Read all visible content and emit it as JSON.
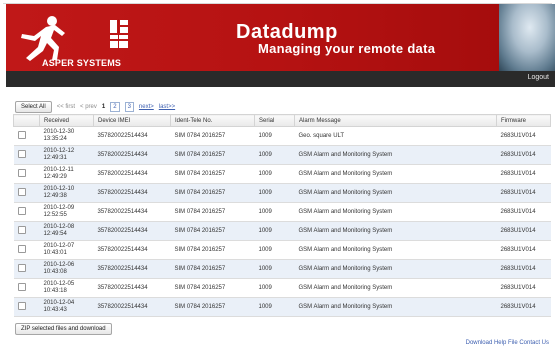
{
  "brand": {
    "company": "ASPER SYSTEMS",
    "title": "Datadump",
    "subtitle": "Managing your remote data"
  },
  "nav": {
    "logout": "Logout"
  },
  "toolbar": {
    "select_all": "Select All",
    "first": "<< first",
    "prev": "< prev",
    "page_current": "1",
    "page_2": "2",
    "page_3": "3",
    "next": "next>",
    "last": "last>>"
  },
  "table": {
    "columns": [
      "",
      "Received",
      "Device IMEI",
      "Ident-Tele No.",
      "Serial",
      "Alarm Message",
      "Firmware"
    ],
    "rows": [
      {
        "date": "2010-12-30",
        "time": "13:35:24",
        "imei": "357820022514434",
        "ident": "SIM 0784 2016257",
        "serial": "1009",
        "message": "Geo. square ULT",
        "firmware": "2683U1V014"
      },
      {
        "date": "2010-12-12",
        "time": "12:49:31",
        "imei": "357820022514434",
        "ident": "SIM 0784 2016257",
        "serial": "1009",
        "message": "GSM Alarm and Monitoring System",
        "firmware": "2683U1V014"
      },
      {
        "date": "2010-12-11",
        "time": "12:49:29",
        "imei": "357820022514434",
        "ident": "SIM 0784 2016257",
        "serial": "1009",
        "message": "GSM Alarm and Monitoring System",
        "firmware": "2683U1V014"
      },
      {
        "date": "2010-12-10",
        "time": "12:49:38",
        "imei": "357820022514434",
        "ident": "SIM 0784 2016257",
        "serial": "1009",
        "message": "GSM Alarm and Monitoring System",
        "firmware": "2683U1V014"
      },
      {
        "date": "2010-12-09",
        "time": "12:52:55",
        "imei": "357820022514434",
        "ident": "SIM 0784 2016257",
        "serial": "1009",
        "message": "GSM Alarm and Monitoring System",
        "firmware": "2683U1V014"
      },
      {
        "date": "2010-12-08",
        "time": "12:49:54",
        "imei": "357820022514434",
        "ident": "SIM 0784 2016257",
        "serial": "1009",
        "message": "GSM Alarm and Monitoring System",
        "firmware": "2683U1V014"
      },
      {
        "date": "2010-12-07",
        "time": "10:43:01",
        "imei": "357820022514434",
        "ident": "SIM 0784 2016257",
        "serial": "1009",
        "message": "GSM Alarm and Monitoring System",
        "firmware": "2683U1V014"
      },
      {
        "date": "2010-12-06",
        "time": "10:43:08",
        "imei": "357820022514434",
        "ident": "SIM 0784 2016257",
        "serial": "1009",
        "message": "GSM Alarm and Monitoring System",
        "firmware": "2683U1V014"
      },
      {
        "date": "2010-12-05",
        "time": "10:43:18",
        "imei": "357820022514434",
        "ident": "SIM 0784 2016257",
        "serial": "1009",
        "message": "GSM Alarm and Monitoring System",
        "firmware": "2683U1V014"
      },
      {
        "date": "2010-12-04",
        "time": "10:43:43",
        "imei": "357820022514434",
        "ident": "SIM 0784 2016257",
        "serial": "1009",
        "message": "GSM Alarm and Monitoring System",
        "firmware": "2683U1V014"
      }
    ]
  },
  "actions": {
    "zip": "ZIP selected files and download"
  },
  "footer": {
    "links": "Download Help File Contact Us"
  },
  "colors": {
    "brand_red": "#b51212",
    "nav_dark": "#2a2a2a",
    "row_alt": "#eaf0f8",
    "link": "#3d5fb0"
  }
}
